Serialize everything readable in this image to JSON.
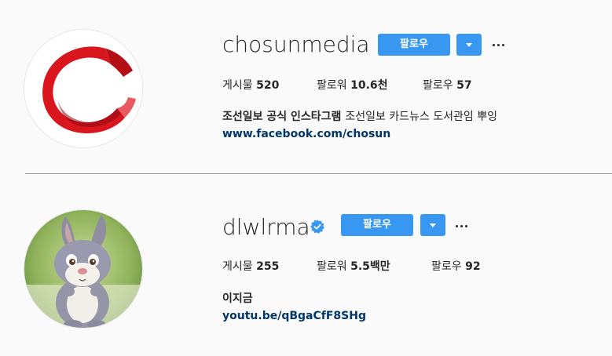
{
  "profiles": [
    {
      "username": "chosunmedia",
      "follow_label": "팔로우",
      "avatar_icon": "chosun-red-logo",
      "stats": {
        "posts_label": "게시물",
        "posts_value": "520",
        "followers_label": "팔로워",
        "followers_value": "10.6천",
        "following_label": "팔로우",
        "following_value": "57"
      },
      "bio_name": "조선일보 공식 인스타그램",
      "bio_text": "조선일보 카드뉴스 도서관임 뿌잉",
      "link": "www.facebook.com/chosun"
    },
    {
      "username": "dlwlrma",
      "verified": true,
      "follow_label": "팔로우",
      "avatar_icon": "cartoon-rabbit",
      "stats": {
        "posts_label": "게시물",
        "posts_value": "255",
        "followers_label": "팔로워",
        "followers_value": "5.5백만",
        "following_label": "팔로우",
        "following_value": "92"
      },
      "bio_name": "이지금",
      "bio_text": "",
      "link": "youtu.be/qBgaCfF8SHg"
    }
  ],
  "colors": {
    "accent": "#3897f0",
    "link": "#003569",
    "logo_red": "#d9161e",
    "background": "#fafafa"
  }
}
